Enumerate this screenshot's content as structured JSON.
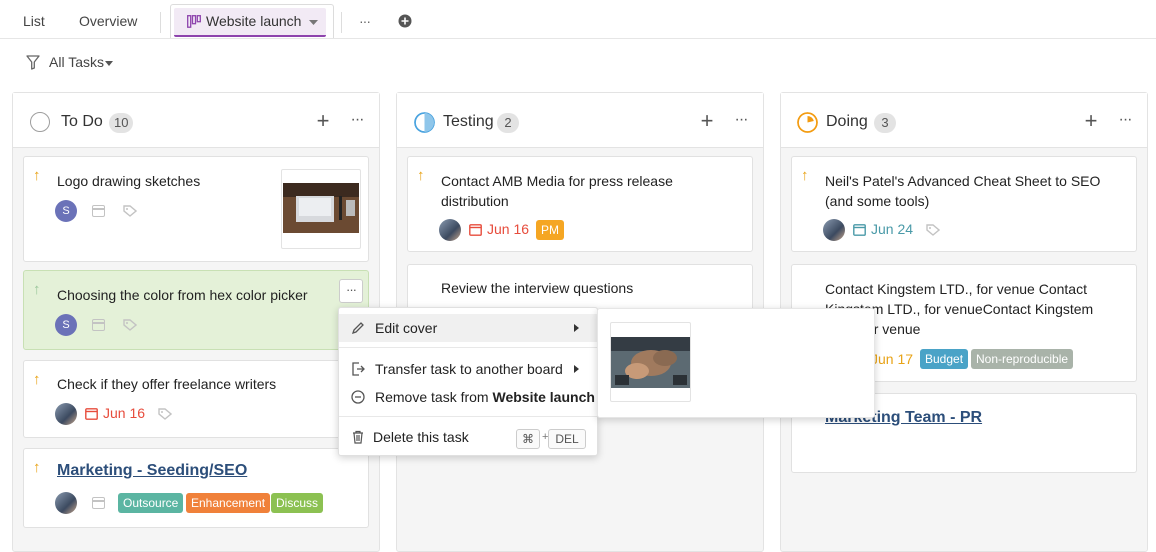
{
  "tabs": {
    "list": "List",
    "overview": "Overview",
    "active": "Website launch",
    "more": "···"
  },
  "filter": {
    "label": "All Tasks"
  },
  "colors": {
    "todo": "#9e9e9e",
    "testing": "#4aa3df",
    "doing": "#f39c12",
    "accent": "#8e44ad",
    "danger": "#e74c3c",
    "date_blue": "#4a9aa8",
    "date_orange": "#e8a317"
  },
  "columns": [
    {
      "title": "To Do",
      "count": "10",
      "status_icon": "circle-empty-icon"
    },
    {
      "title": "Testing",
      "count": "2",
      "status_icon": "circle-half-icon"
    },
    {
      "title": "Doing",
      "count": "3",
      "status_icon": "circle-progress-icon"
    }
  ],
  "todo_cards": [
    {
      "title": "Logo drawing sketches",
      "avatar": "S"
    },
    {
      "title": "Choosing the color from hex color picker",
      "avatar": "S"
    },
    {
      "title": "Check if they offer freelance writers",
      "date": "Jun 16"
    },
    {
      "title": "Marketing - Seeding/SEO",
      "labels": [
        "Outsource",
        "Enhancement",
        "Discuss"
      ]
    }
  ],
  "testing_cards": [
    {
      "title_line1": "Contact AMB Media for press release",
      "title_line2": "distribution",
      "date": "Jun 16",
      "label": "PM"
    },
    {
      "title": "Review the interview questions"
    }
  ],
  "doing_cards": [
    {
      "title_line1": "Neil's Patel's Advanced Cheat Sheet to SEO",
      "title_line2": "(and some tools)",
      "date": "Jun 24"
    },
    {
      "title_line1": "Contact Kingstem LTD., for venue Contact",
      "title_line2": "Kingstem LTD., for venueContact Kingstem",
      "title_line3": "LTD., for venue",
      "date": "Jun 17",
      "labels": [
        "Budget",
        "Non-reproducible"
      ]
    },
    {
      "title": "Marketing Team - PR"
    }
  ],
  "label_colors": {
    "Outsource": "#5bb5a2",
    "Enhancement": "#f0813a",
    "Discuss": "#8cc152",
    "PM": "#f5a623",
    "Budget": "#4aa3c7",
    "Non-reproducible": "#a9b3a9"
  },
  "context_menu": {
    "edit_cover": "Edit cover",
    "transfer": "Transfer task to another board",
    "remove_prefix": "Remove task from ",
    "remove_board": "Website launch",
    "delete": "Delete this task",
    "key_cmd": "⌘",
    "key_plus": "+",
    "key_del": "DEL"
  }
}
